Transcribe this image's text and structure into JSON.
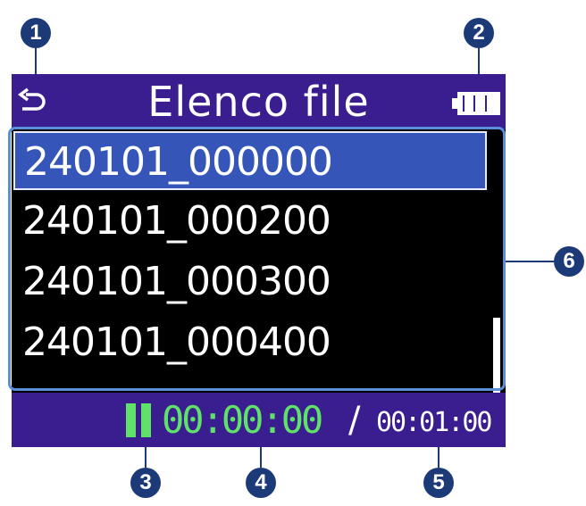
{
  "header": {
    "title": "Elenco file",
    "back_icon": "back-arrow-icon",
    "battery_icon": "battery-icon"
  },
  "file_list": {
    "items": [
      {
        "name": "240101_000000",
        "selected": true
      },
      {
        "name": "240101_000200",
        "selected": false
      },
      {
        "name": "240101_000300",
        "selected": false
      },
      {
        "name": "240101_000400",
        "selected": false
      }
    ],
    "scroll_position": 0.75
  },
  "status": {
    "state_icon": "pause-icon",
    "current_time": "00:00:00",
    "separator": "/",
    "total_time": "00:01:00"
  },
  "callouts": [
    "1",
    "2",
    "3",
    "4",
    "5",
    "6"
  ],
  "colors": {
    "bar": "#3a1d8e",
    "selection": "#3556b8",
    "time_green": "#5fe16a",
    "callout": "#1d3a78",
    "frame": "#5a8ed8"
  }
}
